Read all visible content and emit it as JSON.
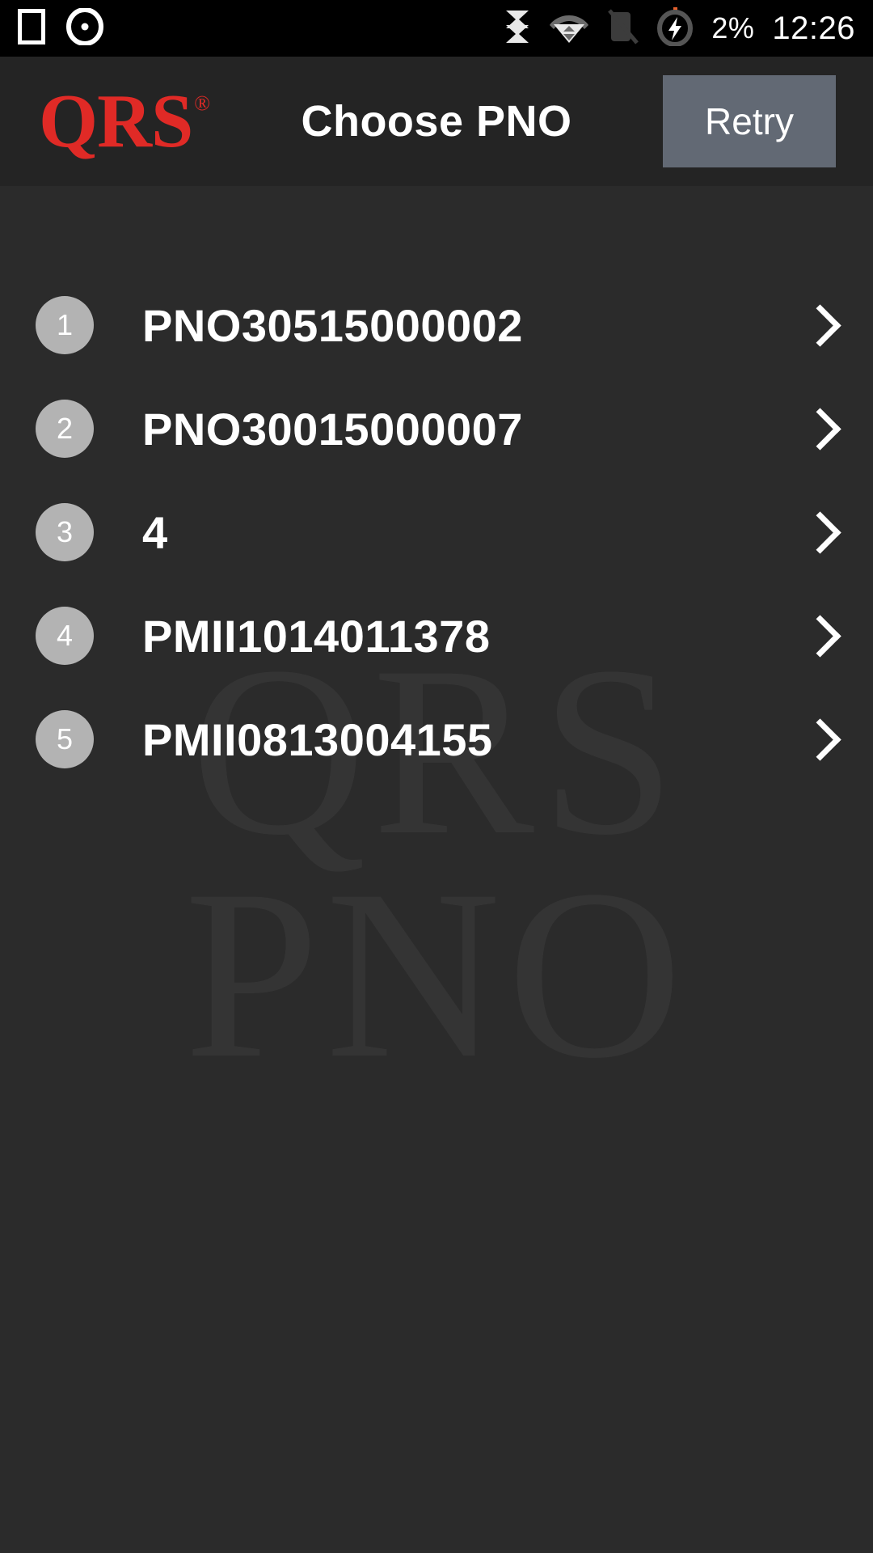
{
  "status_bar": {
    "left_icons": [
      "sim-card-icon",
      "record-circle-icon"
    ],
    "right_icons": [
      "data-transfer-icon",
      "wifi-icon",
      "vibrate-off-icon",
      "battery-charging-icon"
    ],
    "battery_percent": "2%",
    "time": "12:26"
  },
  "header": {
    "logo_text": "QRS",
    "logo_registered": "®",
    "title": "Choose PNO",
    "retry_label": "Retry"
  },
  "watermark": {
    "line1": "QRS",
    "line2": "PNO"
  },
  "list": {
    "items": [
      {
        "index": "1",
        "label": "PNO30515000002"
      },
      {
        "index": "2",
        "label": "PNO30015000007"
      },
      {
        "index": "3",
        "label": "4"
      },
      {
        "index": "4",
        "label": "PMII1014011378"
      },
      {
        "index": "5",
        "label": "PMII0813004155"
      }
    ]
  },
  "colors": {
    "brand_red": "#e02a26",
    "header_bg": "#242424",
    "content_bg": "#2b2b2b",
    "retry_bg": "#626974",
    "badge_bg": "#b3b3b3"
  }
}
